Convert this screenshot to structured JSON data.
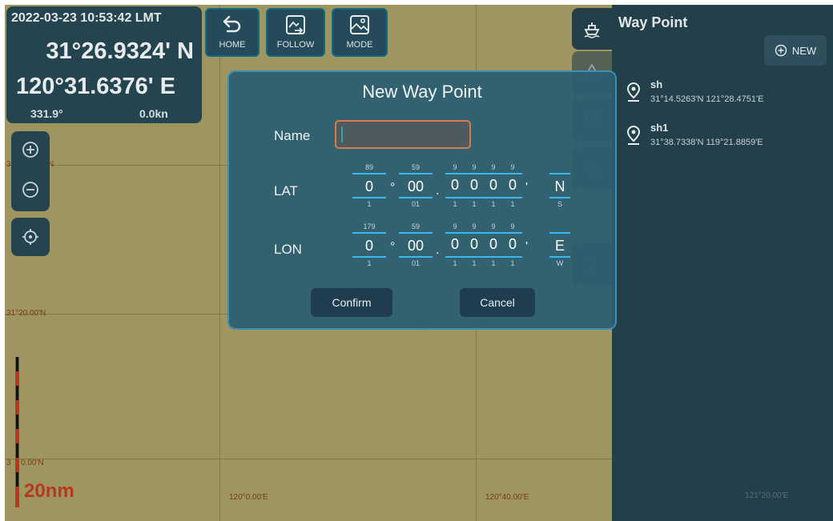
{
  "colors": {
    "map_bg": "#9e9561",
    "panel_bg": "#24454f",
    "dialog_bg": "#2a5c70",
    "accent_blue": "#3ab6f0",
    "input_border": "#d97a4a",
    "scale_red": "#b8381f"
  },
  "status": {
    "datetime": "2022-03-23 10:53:42 LMT",
    "latitude": "31°26.9324' N",
    "longitude": "120°31.6376' E",
    "heading": "331.9°",
    "speed": "0.0kn"
  },
  "toolbar": {
    "home_label": "HOME",
    "follow_label": "FOLLOW",
    "mode_label": "MODE"
  },
  "map": {
    "grid_labels": {
      "lat_top": "31°3",
      "lat_top_end": "N",
      "lat_mid": "31°20.00'N",
      "lat_bottom_a": "3",
      "lat_bottom_b": "0.00'N",
      "lon_left": "120°0.00'E",
      "lon_mid": "120°40.00'E",
      "lon_right": "121°20.00'E"
    },
    "scale": "20nm"
  },
  "waypoint_panel": {
    "title": "Way Point",
    "new_label": "NEW",
    "items": [
      {
        "name": "sh",
        "coords": "31°14.5263'N 121°28.4751'E"
      },
      {
        "name": "sh1",
        "coords": "31°38.7338'N 119°21.8859'E"
      }
    ]
  },
  "dialog": {
    "title": "New Way Point",
    "name_label": "Name",
    "name_value": "",
    "lat_label": "LAT",
    "lon_label": "LON",
    "lat": {
      "deg": {
        "up": "89",
        "value": "0",
        "down": "1"
      },
      "min": {
        "up": "59",
        "value": "00",
        "down": "01"
      },
      "d1": {
        "up": "9",
        "value": "0",
        "down": "1"
      },
      "d2": {
        "up": "9",
        "value": "0",
        "down": "1"
      },
      "d3": {
        "up": "9",
        "value": "0",
        "down": "1"
      },
      "d4": {
        "up": "9",
        "value": "0",
        "down": "1"
      },
      "hem": {
        "up": "",
        "value": "N",
        "down": "S"
      }
    },
    "lon": {
      "deg": {
        "up": "179",
        "value": "0",
        "down": "1"
      },
      "min": {
        "up": "59",
        "value": "00",
        "down": "01"
      },
      "d1": {
        "up": "9",
        "value": "0",
        "down": "1"
      },
      "d2": {
        "up": "9",
        "value": "0",
        "down": "1"
      },
      "d3": {
        "up": "9",
        "value": "0",
        "down": "1"
      },
      "d4": {
        "up": "9",
        "value": "0",
        "down": "1"
      },
      "hem": {
        "up": "",
        "value": "E",
        "down": "W"
      }
    },
    "symbols": {
      "degree": "°",
      "dot": ".",
      "minute": "'"
    },
    "confirm_label": "Confirm",
    "cancel_label": "Cancel"
  },
  "icons": {
    "home": "undo-arrow-icon",
    "follow": "follow-image-icon",
    "mode": "mode-image-icon",
    "zoom_in": "zoom-in-icon",
    "zoom_out": "zoom-out-icon",
    "locate": "crosshair-icon",
    "ship": "ship-icon",
    "waypoint": "location-pin-icon",
    "add": "plus-circle-icon"
  }
}
